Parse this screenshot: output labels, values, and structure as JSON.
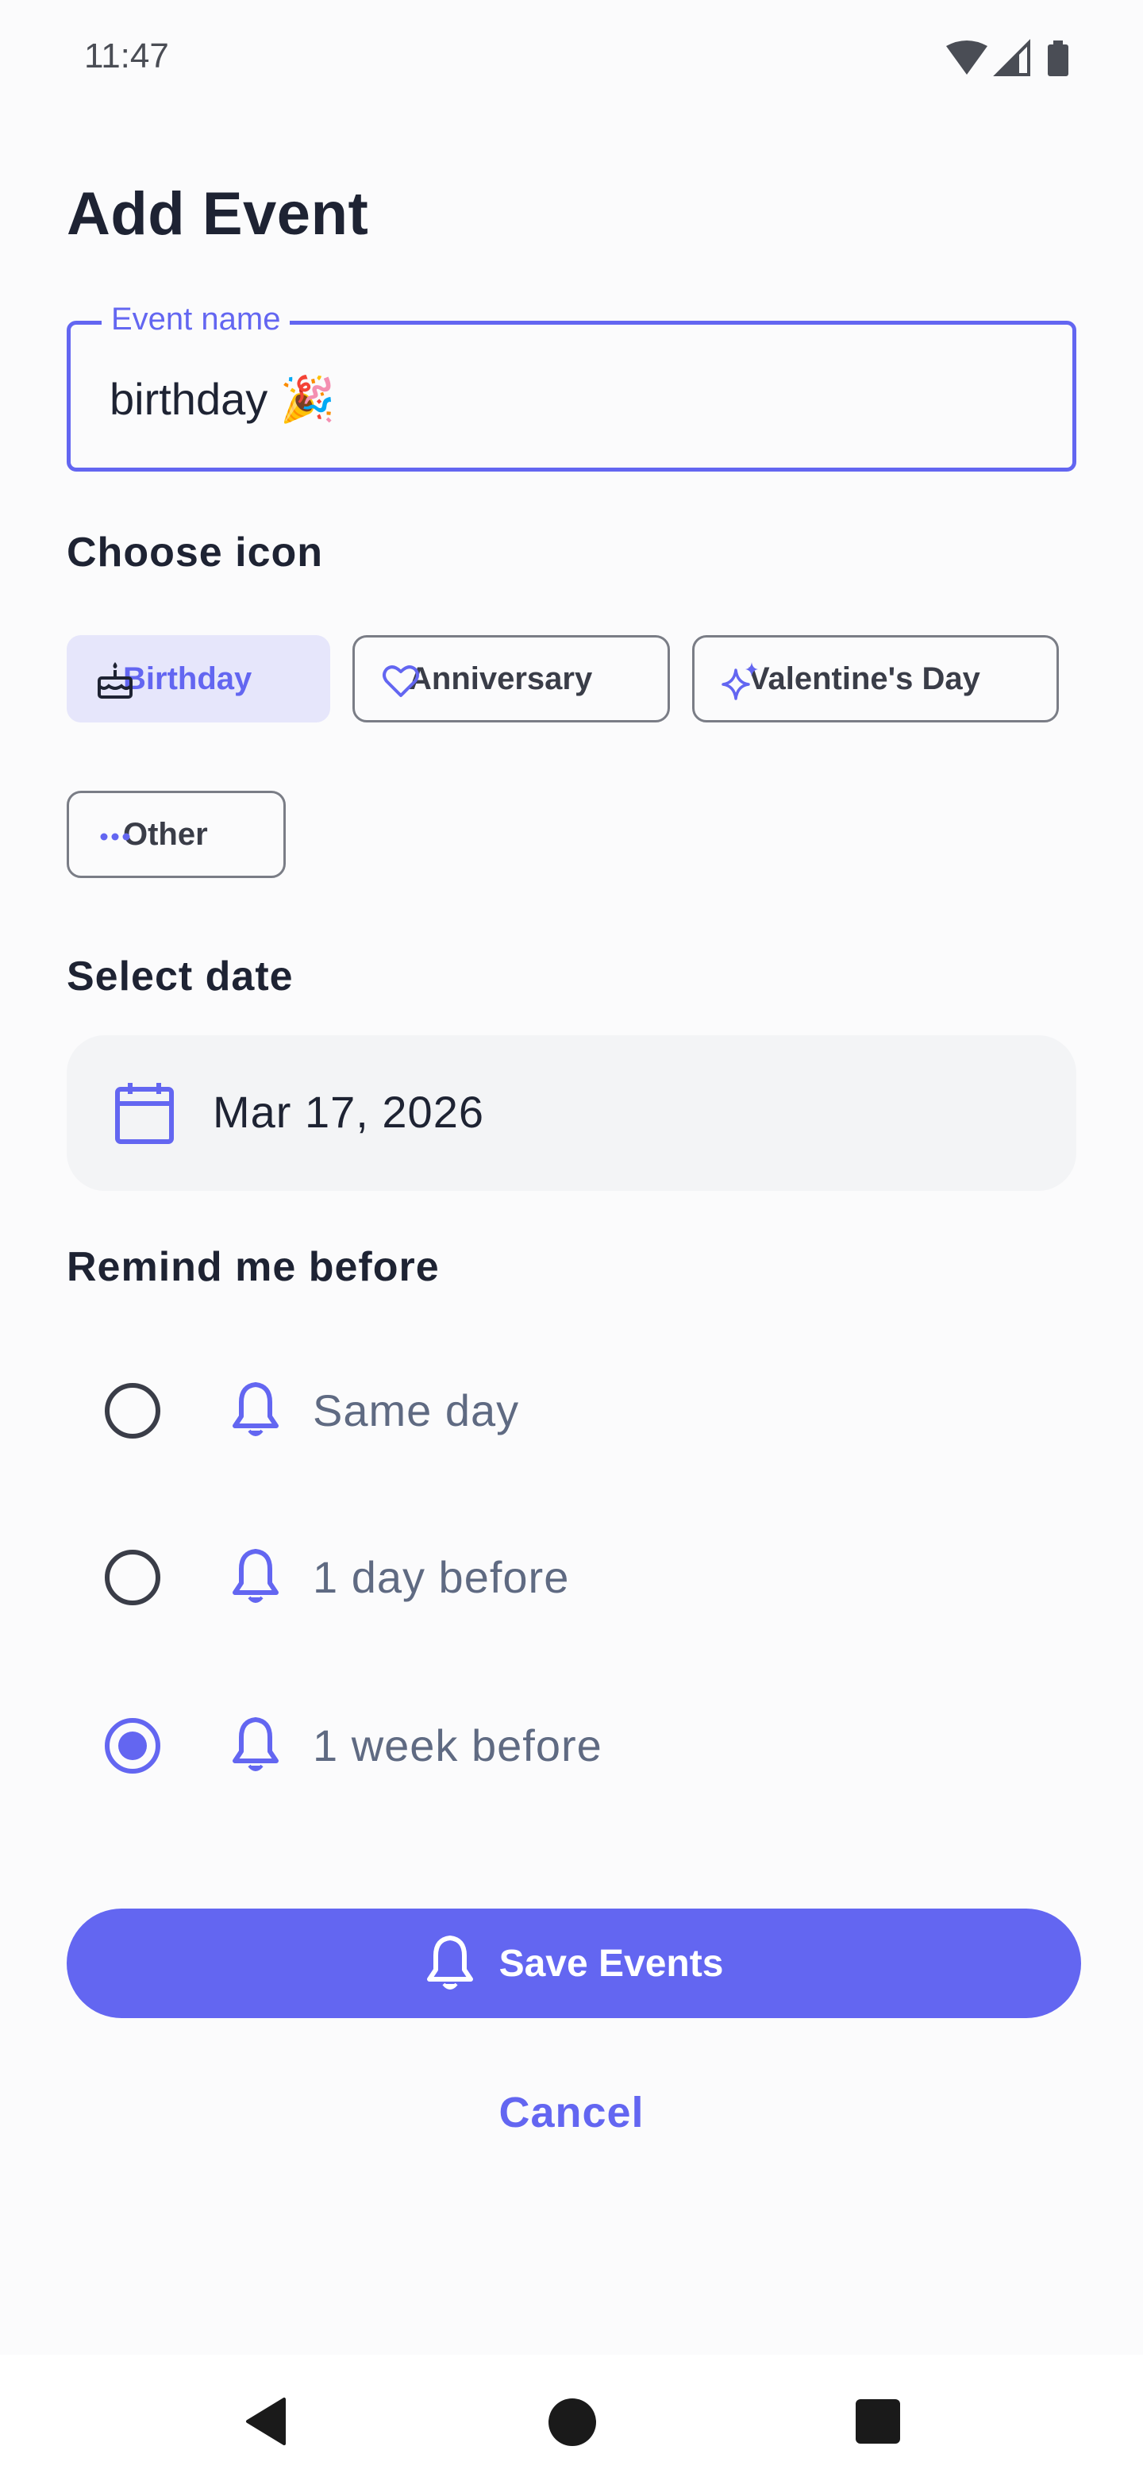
{
  "status_bar": {
    "time": "11:47",
    "icons": [
      "wifi-icon",
      "signal-icon",
      "battery-icon"
    ]
  },
  "page": {
    "title": "Add Event"
  },
  "event_name": {
    "label": "Event name",
    "value": "birthday 🎉"
  },
  "choose_icon": {
    "label": "Choose icon",
    "options": [
      {
        "label": "Birthday",
        "icon": "cake-icon",
        "selected": true
      },
      {
        "label": "Anniversary",
        "icon": "heart-icon",
        "selected": false
      },
      {
        "label": "Valentine's Day",
        "icon": "sparkle-icon",
        "selected": false
      },
      {
        "label": "Other",
        "icon": "more-dots-icon",
        "selected": false
      }
    ]
  },
  "select_date": {
    "label": "Select date",
    "value": "Mar 17, 2026",
    "icon": "calendar-icon"
  },
  "remind": {
    "label": "Remind me before",
    "options": [
      {
        "label": "Same day",
        "selected": false
      },
      {
        "label": "1 day before",
        "selected": false
      },
      {
        "label": "1 week before",
        "selected": true
      }
    ]
  },
  "actions": {
    "save_label": "Save Events",
    "cancel_label": "Cancel"
  },
  "nav_bar": {
    "items": [
      "back-icon",
      "home-icon",
      "recents-icon"
    ]
  },
  "colors": {
    "accent": "#6366F1",
    "accent_light": "#E6E6FB",
    "text": "#1E2333",
    "muted_text": "#5F6A82"
  }
}
